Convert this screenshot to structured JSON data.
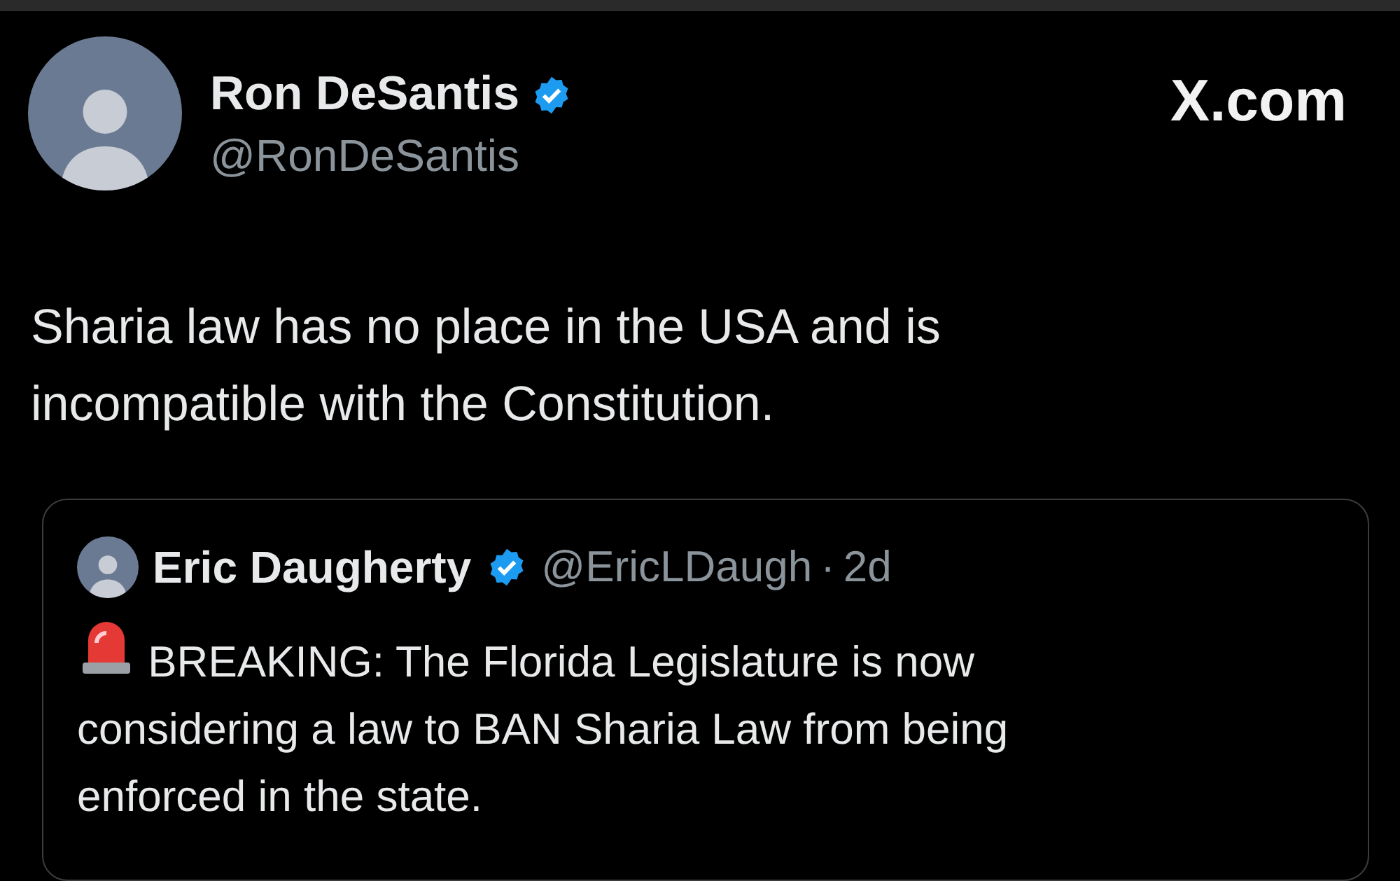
{
  "post": {
    "author": {
      "name": "Ron DeSantis",
      "handle": "@RonDeSantis",
      "verified": true
    },
    "source_label": "X.com",
    "text": "Sharia law has no place in the USA and is incompatible with the Constitution."
  },
  "quoted_post": {
    "author": {
      "name": "Eric Daugherty",
      "handle": "@EricLDaugh",
      "verified": true
    },
    "separator": "·",
    "age": "2d",
    "text": "BREAKING: The Florida Legislature is now considering a law to BAN Sharia Law from being enforced in the state."
  }
}
